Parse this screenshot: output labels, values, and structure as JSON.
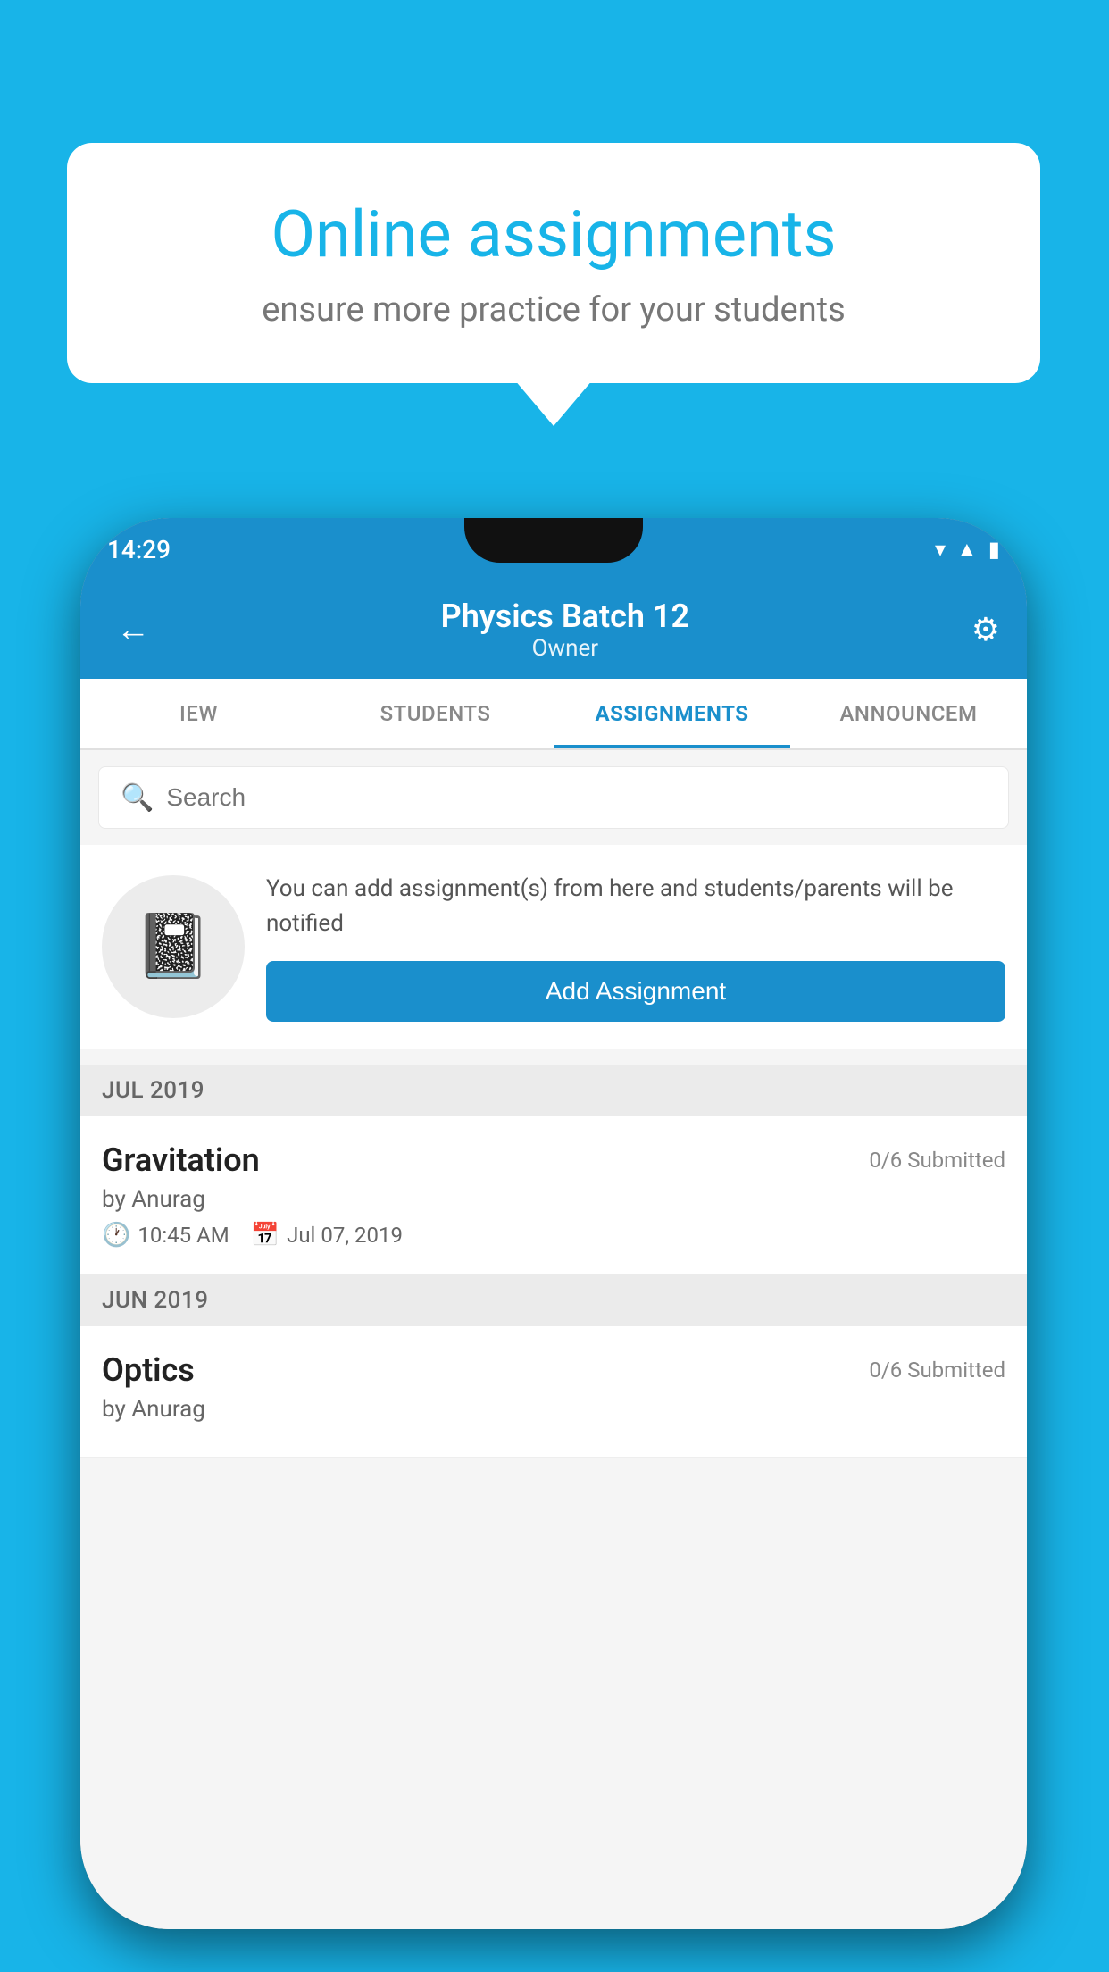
{
  "background_color": "#18b4e8",
  "promo": {
    "title": "Online assignments",
    "subtitle": "ensure more practice for your students"
  },
  "status_bar": {
    "time": "14:29",
    "icons": [
      "wifi",
      "signal",
      "battery"
    ]
  },
  "app_bar": {
    "title": "Physics Batch 12",
    "subtitle": "Owner",
    "back_label": "←",
    "settings_label": "⚙"
  },
  "tabs": [
    {
      "label": "IEW",
      "active": false
    },
    {
      "label": "STUDENTS",
      "active": false
    },
    {
      "label": "ASSIGNMENTS",
      "active": true
    },
    {
      "label": "ANNOUNCEM",
      "active": false
    }
  ],
  "search": {
    "placeholder": "Search"
  },
  "empty_state": {
    "description": "You can add assignment(s) from here and students/parents will be notified",
    "button_label": "Add Assignment",
    "icon": "📓"
  },
  "sections": [
    {
      "month": "JUL 2019",
      "assignments": [
        {
          "name": "Gravitation",
          "submitted": "0/6 Submitted",
          "by": "by Anurag",
          "time": "10:45 AM",
          "date": "Jul 07, 2019"
        }
      ]
    },
    {
      "month": "JUN 2019",
      "assignments": [
        {
          "name": "Optics",
          "submitted": "0/6 Submitted",
          "by": "by Anurag",
          "time": "",
          "date": ""
        }
      ]
    }
  ]
}
